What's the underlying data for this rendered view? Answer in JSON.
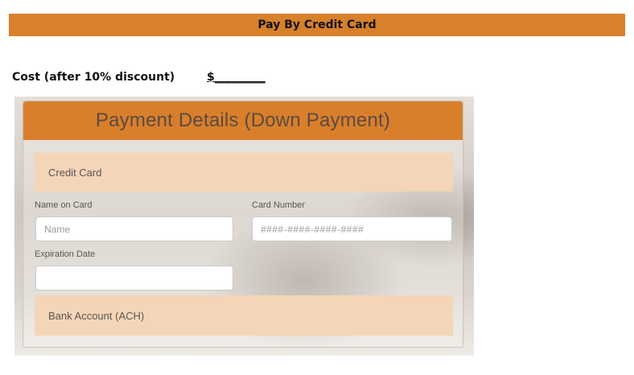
{
  "header": {
    "title": "Pay By Credit Card"
  },
  "cost": {
    "label": "Cost (after 10% discount)",
    "value": "$_________"
  },
  "payment_form": {
    "title": "Payment Details (Down Payment)",
    "credit_card_section": "Credit Card",
    "name_on_card": {
      "label": "Name on Card",
      "placeholder": "Name",
      "value": ""
    },
    "card_number": {
      "label": "Card Number",
      "placeholder": "####-####-####-####",
      "value": ""
    },
    "expiration_date": {
      "label": "Expiration Date",
      "placeholder": "",
      "value": ""
    },
    "bank_account_section": "Bank Account (ACH)"
  },
  "colors": {
    "accent": "#d8802a",
    "section_band": "#f4d5b7",
    "header_text": "#5b4a43"
  }
}
